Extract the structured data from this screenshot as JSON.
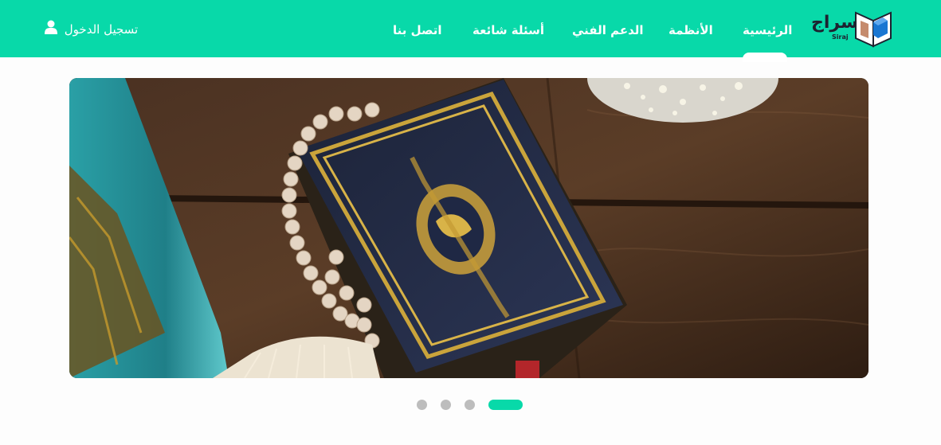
{
  "brand": {
    "name_ar": "سراج",
    "name_en": "Siraj",
    "colors": {
      "primary": "#08d9a9",
      "logo_blue": "#1976d2",
      "logo_tan": "#c58b6d"
    }
  },
  "nav": {
    "items": [
      {
        "label": "الرئيسية",
        "active": true
      },
      {
        "label": "الأنظمة",
        "active": false
      },
      {
        "label": "الدعم الفني",
        "active": false
      },
      {
        "label": "أسئلة شائعة",
        "active": false
      },
      {
        "label": "اتصل بنا",
        "active": false
      }
    ]
  },
  "login": {
    "label": "تسجيل الدخول",
    "icon": "user-icon"
  },
  "slider": {
    "slide_count": 4,
    "active_slide": 1,
    "image_description": "Quran with gold ornament and prayer beads on wooden table"
  }
}
